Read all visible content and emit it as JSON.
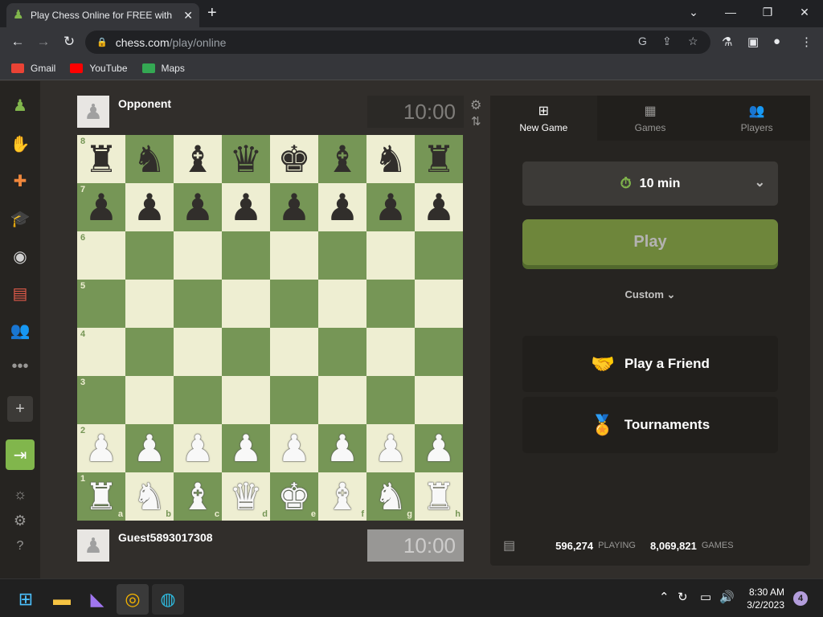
{
  "browser": {
    "tab_title": "Play Chess Online for FREE with F",
    "url_domain": "chess.com",
    "url_path": "/play/online",
    "bookmarks": [
      {
        "label": "Gmail",
        "color": "#ea4335"
      },
      {
        "label": "YouTube",
        "color": "#ff0000"
      },
      {
        "label": "Maps",
        "color": "#34a853"
      }
    ]
  },
  "game": {
    "opponent_name": "Opponent",
    "opponent_clock": "10:00",
    "player_name": "Guest5893017308",
    "player_clock": "10:00",
    "rank_labels": [
      "8",
      "7",
      "6",
      "5",
      "4",
      "3",
      "2",
      "1"
    ],
    "file_labels": [
      "a",
      "b",
      "c",
      "d",
      "e",
      "f",
      "g",
      "h"
    ],
    "board": [
      [
        "br",
        "bn",
        "bb",
        "bq",
        "bk",
        "bb",
        "bn",
        "br"
      ],
      [
        "bp",
        "bp",
        "bp",
        "bp",
        "bp",
        "bp",
        "bp",
        "bp"
      ],
      [
        "",
        "",
        "",
        "",
        "",
        "",
        "",
        ""
      ],
      [
        "",
        "",
        "",
        "",
        "",
        "",
        "",
        ""
      ],
      [
        "",
        "",
        "",
        "",
        "",
        "",
        "",
        ""
      ],
      [
        "",
        "",
        "",
        "",
        "",
        "",
        "",
        ""
      ],
      [
        "wp",
        "wp",
        "wp",
        "wp",
        "wp",
        "wp",
        "wp",
        "wp"
      ],
      [
        "wr",
        "wn",
        "wb",
        "wq",
        "wk",
        "wb",
        "wn",
        "wr"
      ]
    ],
    "colors": {
      "light": "#eeeed2",
      "dark": "#769656"
    }
  },
  "panel": {
    "tabs": [
      {
        "label": "New Game",
        "icon": "plus-square-icon"
      },
      {
        "label": "Games",
        "icon": "checkerboard-icon"
      },
      {
        "label": "Players",
        "icon": "players-icon"
      }
    ],
    "time_control": "10 min",
    "play_label": "Play",
    "custom_label": "Custom",
    "play_friend_label": "Play a Friend",
    "tournaments_label": "Tournaments",
    "playing_count": "596,274",
    "playing_label": "PLAYING",
    "games_count": "8,069,821",
    "games_label": "GAMES",
    "accent": "#81b64c"
  },
  "taskbar": {
    "time": "8:30 AM",
    "date": "3/2/2023",
    "notification_count": "4"
  }
}
